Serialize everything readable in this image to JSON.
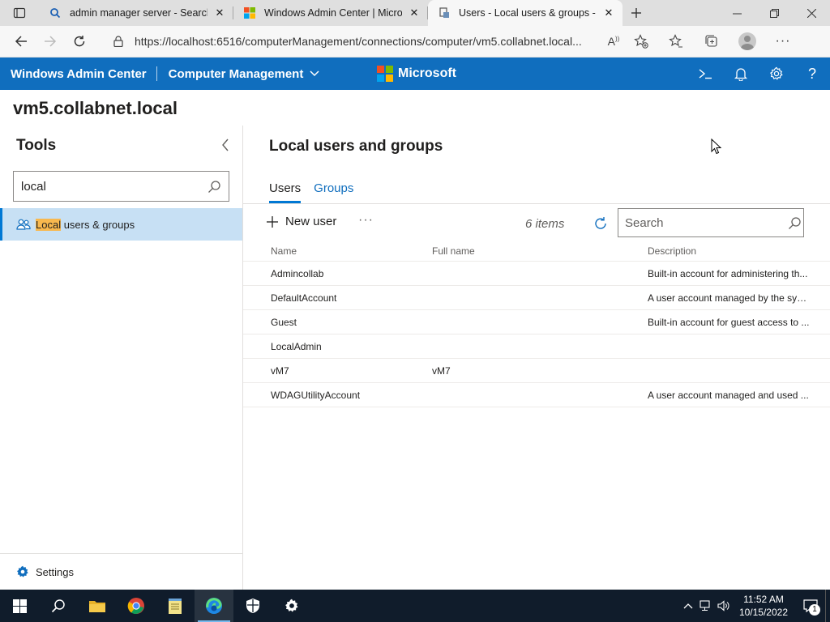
{
  "browser": {
    "tabs": [
      {
        "title": "admin manager server - Search",
        "active": false
      },
      {
        "title": "Windows Admin Center | Microsoft",
        "active": false
      },
      {
        "title": "Users - Local users & groups - Computer Management",
        "active": true
      }
    ],
    "url": "https://localhost:6516/computerManagement/connections/computer/vm5.collabnet.local..."
  },
  "header": {
    "app_title": "Windows Admin Center",
    "solution": "Computer Management",
    "brand": "Microsoft"
  },
  "server_name": "vm5.collabnet.local",
  "tools": {
    "title": "Tools",
    "search_value": "local",
    "items": [
      {
        "highlight": "Local",
        "rest": " users & groups",
        "selected": true
      }
    ],
    "settings_label": "Settings"
  },
  "main": {
    "title": "Local users and groups",
    "tabs": [
      {
        "label": "Users",
        "active": true
      },
      {
        "label": "Groups",
        "active": false
      }
    ],
    "toolbar": {
      "new_user_label": "New user",
      "more_label": "···",
      "item_count": "6 items",
      "search_placeholder": "Search"
    },
    "columns": [
      "Name",
      "Full name",
      "Description"
    ],
    "rows": [
      {
        "name": "Admincollab",
        "full_name": "",
        "description": "Built-in account for administering th..."
      },
      {
        "name": "DefaultAccount",
        "full_name": "",
        "description": "A user account managed by the syst..."
      },
      {
        "name": "Guest",
        "full_name": "",
        "description": "Built-in account for guest access to ..."
      },
      {
        "name": "LocalAdmin",
        "full_name": "",
        "description": ""
      },
      {
        "name": "vM7",
        "full_name": "vM7",
        "description": ""
      },
      {
        "name": "WDAGUtilityAccount",
        "full_name": "",
        "description": "A user account managed and used ..."
      }
    ]
  },
  "taskbar": {
    "time": "11:52 AM",
    "date": "10/15/2022",
    "notification_count": "1"
  },
  "colors": {
    "header_blue": "#106ebe",
    "accent": "#0078d4",
    "selected_bg": "#c7e0f4",
    "highlight": "#f8b84e",
    "taskbar": "#101c2b"
  }
}
